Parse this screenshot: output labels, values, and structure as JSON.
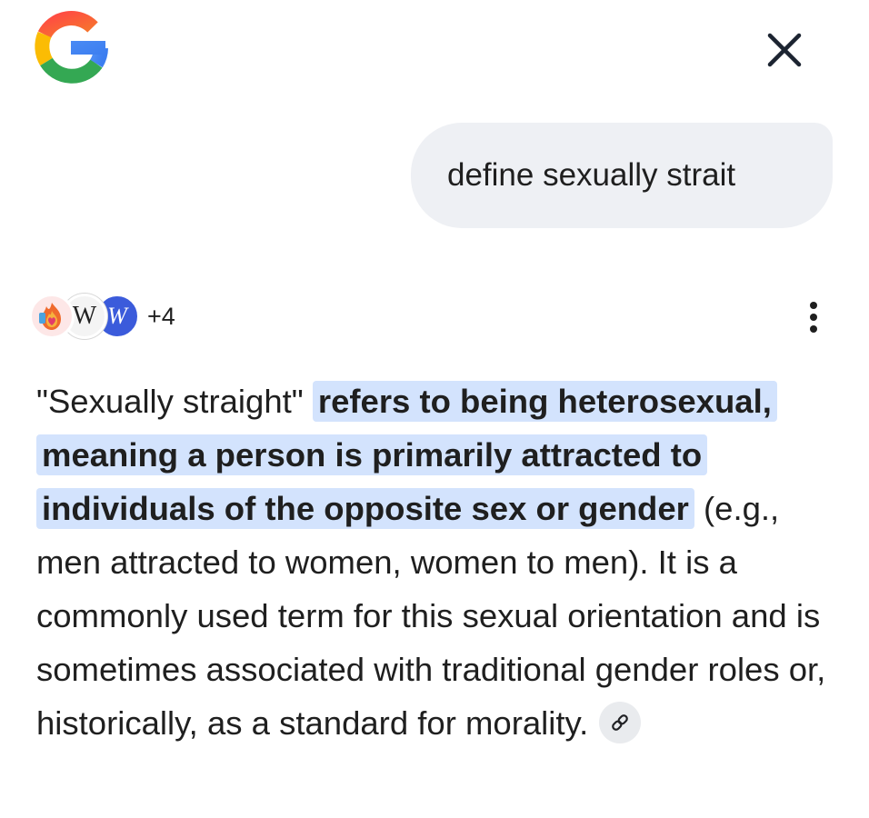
{
  "header": {
    "logo_icon": "google-g-icon",
    "close_icon": "close-icon"
  },
  "query": {
    "text": "define sexually strait"
  },
  "sources": {
    "icons": [
      "fire-heart-source-icon",
      "wiktionary-source-icon",
      "wikipedia-source-icon"
    ],
    "wiktionary_letter": "W",
    "wikipedia_letter": "W",
    "more_count": "+4",
    "menu_icon": "more-vert-icon"
  },
  "answer": {
    "lead": "\"Sexually straight\" ",
    "highlight": "refers to being heterosexual, meaning a person is primarily attracted to individuals of the opposite sex or gender",
    "rest": " (e.g., men attracted to women, women to men). It is a commonly used term for this sexual orientation and is sometimes associated with traditional gender roles or, historically, as a standard for morality.",
    "link_icon": "link-icon"
  },
  "colors": {
    "highlight": "#d3e3fd",
    "bubble": "#eef0f4",
    "text": "#1f1f1f"
  }
}
